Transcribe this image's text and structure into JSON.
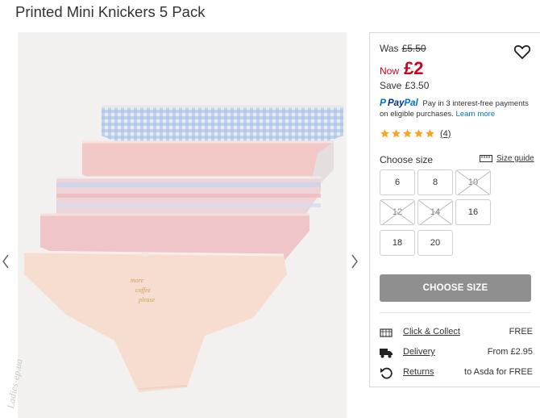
{
  "product": {
    "title": "Printed Mini Knickers 5 Pack"
  },
  "watermark": {
    "text": "Ladies-ep.ua"
  },
  "gallery": {
    "image_name": "five pack of knickers product photo"
  },
  "price": {
    "was_label": "Was",
    "was_value": "£5.50",
    "now_label": "Now",
    "now_value": "£2",
    "save_label": "Save",
    "save_value": "£3.50",
    "accent_color": "#d0021b"
  },
  "paypal": {
    "logo_pay": "Pay",
    "logo_pal": "Pal",
    "text": "Pay in 3 interest-free payments on eligible purchases.",
    "link": "Learn more"
  },
  "rating": {
    "stars": 5,
    "count": "(4)",
    "star_color": "#f5a623"
  },
  "sizes": {
    "label": "Choose size",
    "guide": "Size guide",
    "options": [
      {
        "label": "6",
        "available": true
      },
      {
        "label": "8",
        "available": true
      },
      {
        "label": "10",
        "available": false
      },
      {
        "label": "12",
        "available": false
      },
      {
        "label": "14",
        "available": false
      },
      {
        "label": "16",
        "available": true
      },
      {
        "label": "18",
        "available": true
      },
      {
        "label": "20",
        "available": true
      }
    ]
  },
  "cta": {
    "label": "CHOOSE SIZE"
  },
  "services": [
    {
      "icon": "store-icon",
      "link": "Click & Collect",
      "value": "FREE"
    },
    {
      "icon": "truck-icon",
      "link": "Delivery",
      "value": "From £2.95"
    },
    {
      "icon": "return-icon",
      "link": "Returns",
      "value": "to Asda for FREE"
    }
  ]
}
